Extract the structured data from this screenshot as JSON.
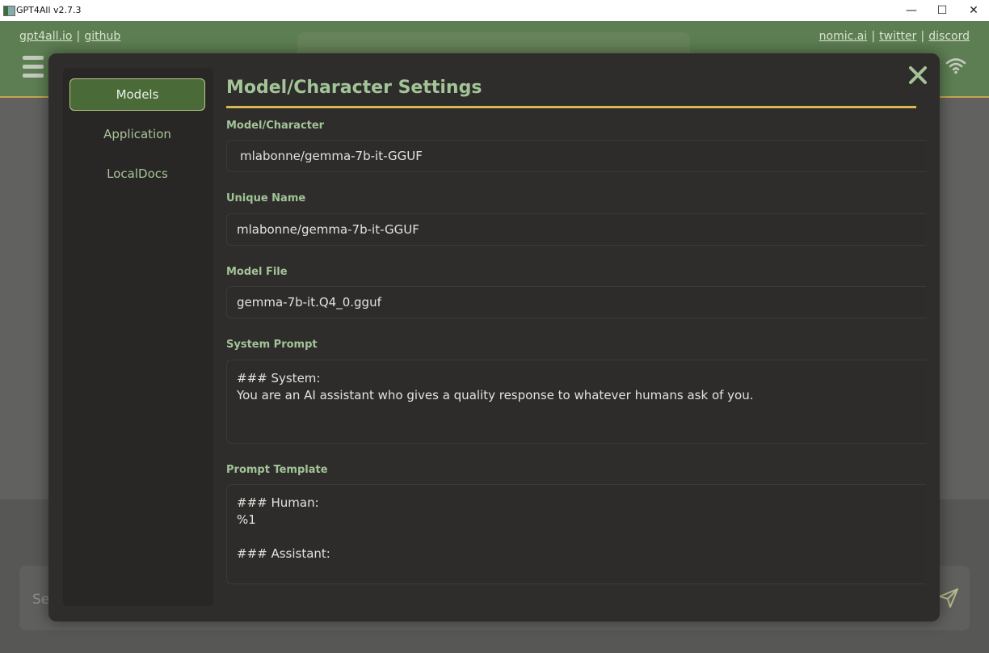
{
  "window": {
    "title": "GPT4All v2.7.3",
    "minimize": "—",
    "maximize": "☐",
    "close": "✕"
  },
  "header": {
    "links_left": [
      "gpt4all.io",
      "github"
    ],
    "links_right": [
      "nomic.ai",
      "twitter",
      "discord"
    ],
    "separator": "|"
  },
  "input": {
    "placeholder_visible": "Se"
  },
  "settings": {
    "sidebar": {
      "items": [
        "Models",
        "Application",
        "LocalDocs"
      ],
      "active": "Models"
    },
    "title": "Model/Character Settings",
    "fields": {
      "model_character": {
        "label": "Model/Character",
        "value": "mlabonne/gemma-7b-it-GGUF"
      },
      "unique_name": {
        "label": "Unique Name",
        "value": "mlabonne/gemma-7b-it-GGUF"
      },
      "model_file": {
        "label": "Model File",
        "value": "gemma-7b-it.Q4_0.gguf"
      },
      "system_prompt": {
        "label": "System Prompt",
        "value": "### System:\nYou are an AI assistant who gives a quality response to whatever humans ask of you."
      },
      "prompt_template": {
        "label": "Prompt Template",
        "value": "### Human:\n%1\n\n### Assistant:"
      }
    }
  },
  "colors": {
    "header_bg": "#5d7d52",
    "accent_gold": "#d8b651",
    "label_green": "#a2c497",
    "dialog_bg": "#2f2d2b"
  }
}
